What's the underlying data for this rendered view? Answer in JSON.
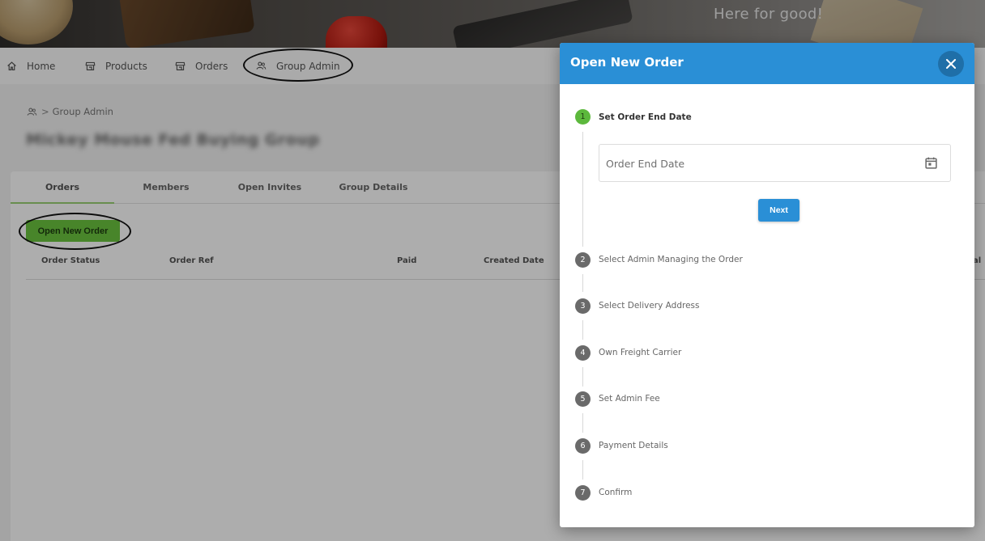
{
  "hero": {
    "tagline": "Here for good!"
  },
  "nav": {
    "items": [
      {
        "label": "Home",
        "icon": "home-icon"
      },
      {
        "label": "Products",
        "icon": "store-icon"
      },
      {
        "label": "Orders",
        "icon": "store-icon"
      },
      {
        "label": "Group Admin",
        "icon": "people-icon"
      }
    ]
  },
  "breadcrumb": {
    "separator": ">",
    "label": "Group Admin"
  },
  "page": {
    "title": "Mickey Mouse Fed Buying Group"
  },
  "tabs": [
    {
      "label": "Orders"
    },
    {
      "label": "Members"
    },
    {
      "label": "Open Invites"
    },
    {
      "label": "Group Details"
    }
  ],
  "toolbar": {
    "open_order_label": "Open New Order"
  },
  "table": {
    "columns": [
      "Order Status",
      "Order Ref",
      "Paid",
      "Created Date",
      "al"
    ]
  },
  "modal": {
    "title": "Open New Order",
    "date_placeholder": "Order End Date",
    "next_label": "Next",
    "steps": [
      {
        "number": "1",
        "label": "Set Order End Date"
      },
      {
        "number": "2",
        "label": "Select Admin Managing the Order"
      },
      {
        "number": "3",
        "label": "Select Delivery Address"
      },
      {
        "number": "4",
        "label": "Own Freight Carrier"
      },
      {
        "number": "5",
        "label": "Set Admin Fee"
      },
      {
        "number": "6",
        "label": "Payment Details"
      },
      {
        "number": "7",
        "label": "Confirm"
      }
    ]
  },
  "colors": {
    "modal_header": "#2a8fd6",
    "active_step": "#5cb83c",
    "open_order_button": "#6ac43f",
    "annotation": "#111111"
  }
}
